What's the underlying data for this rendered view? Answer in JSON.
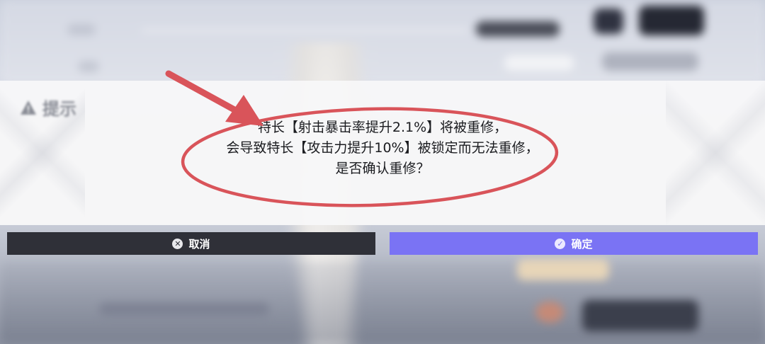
{
  "dialog": {
    "title": "提示",
    "message": [
      "特长【射击暴击率提升2.1%】将被重修，",
      "会导致特长【攻击力提升10%】被锁定而无法重修，",
      "是否确认重修？"
    ]
  },
  "buttons": {
    "cancel": {
      "label": "取消",
      "icon": "close-circle-icon"
    },
    "confirm": {
      "label": "确定",
      "icon": "check-circle-icon"
    }
  },
  "colors": {
    "confirm_button": "#7a73f4",
    "cancel_button": "#2f3038",
    "annotation": "#d9545a"
  }
}
